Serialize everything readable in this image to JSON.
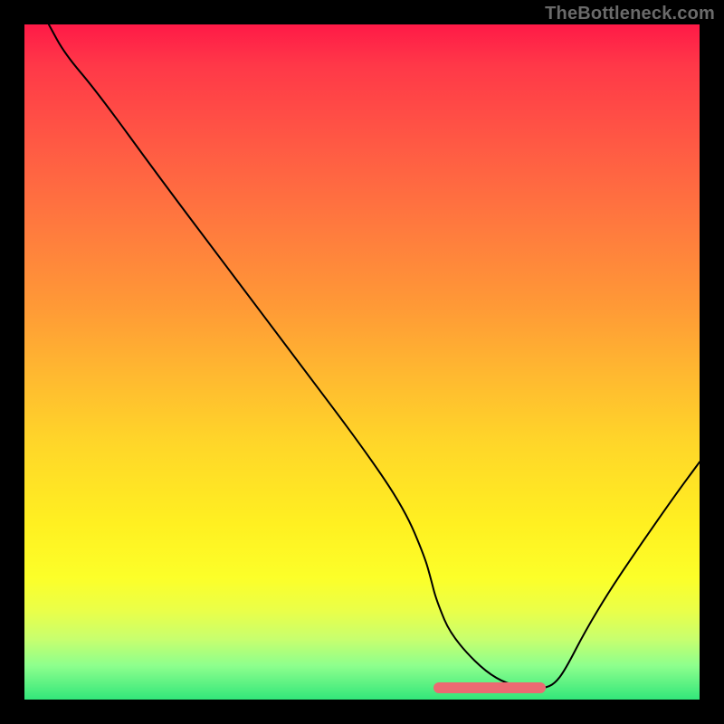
{
  "watermark": "TheBottleneck.com",
  "chart_data": {
    "type": "line",
    "title": "",
    "xlabel": "",
    "ylabel": "",
    "xlim": [
      0,
      100
    ],
    "ylim": [
      0,
      100
    ],
    "grid": false,
    "legend": false,
    "series": [
      {
        "name": "bottleneck-curve",
        "x": [
          3.6,
          6.0,
          10.7,
          20.1,
          30.2,
          40.2,
          50.3,
          56.3,
          59.3,
          60.2,
          61.0,
          63.4,
          70.0,
          76.0,
          77.0,
          78.5,
          80.1,
          83.1,
          86.7,
          91.5,
          96.4,
          100.0
        ],
        "values": [
          100.0,
          95.6,
          90.1,
          77.2,
          63.8,
          50.5,
          37.1,
          28.2,
          21.1,
          17.9,
          14.7,
          9.0,
          2.5,
          1.7,
          1.7,
          2.3,
          4.4,
          10.2,
          16.2,
          23.3,
          30.3,
          35.2
        ]
      }
    ],
    "optimal_band": {
      "x_start": 60.6,
      "x_end": 77.2,
      "y": 1.7
    },
    "gradient_stops": [
      {
        "pos": 0,
        "color": "#ff1a47"
      },
      {
        "pos": 6,
        "color": "#ff3848"
      },
      {
        "pos": 18,
        "color": "#ff5a44"
      },
      {
        "pos": 30,
        "color": "#ff7a3e"
      },
      {
        "pos": 42,
        "color": "#ff9a36"
      },
      {
        "pos": 52,
        "color": "#ffb930"
      },
      {
        "pos": 62,
        "color": "#ffd629"
      },
      {
        "pos": 74,
        "color": "#fff021"
      },
      {
        "pos": 82,
        "color": "#fcff29"
      },
      {
        "pos": 87,
        "color": "#e9ff4a"
      },
      {
        "pos": 91,
        "color": "#c8ff6e"
      },
      {
        "pos": 95,
        "color": "#8dff8d"
      },
      {
        "pos": 100,
        "color": "#32e67a"
      }
    ]
  }
}
